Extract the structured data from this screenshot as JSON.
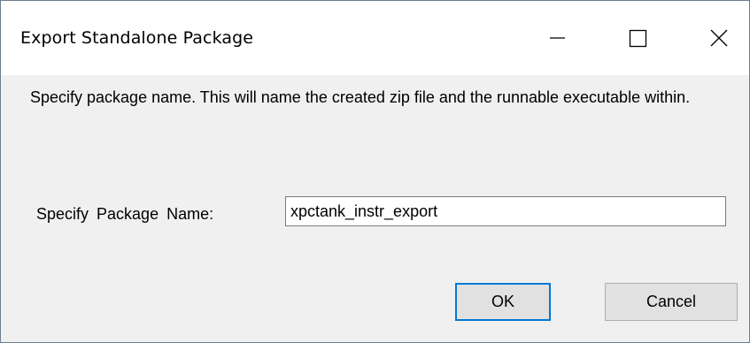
{
  "window": {
    "title": "Export Standalone Package",
    "controls": {
      "minimize_icon": "minimize-icon",
      "maximize_icon": "maximize-icon",
      "close_icon": "close-icon"
    }
  },
  "dialog": {
    "instruction": "Specify package name. This will name the created zip file and the runnable executable within.",
    "field_label": "Specify Package Name:",
    "package_name": "xpctank_instr_export",
    "ok_label": "OK",
    "cancel_label": "Cancel"
  },
  "colors": {
    "title_bar": "#ffffff",
    "dialog_bg": "#f0f0f0",
    "default_button_focus": "#0078d7"
  }
}
